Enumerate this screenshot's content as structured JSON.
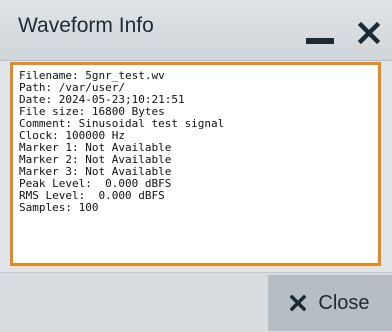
{
  "dialog": {
    "title": "Waveform Info",
    "close_label": "Close"
  },
  "info": {
    "lines": [
      "Filename: 5gnr_test.wv",
      "Path: /var/user/",
      "Date: 2024-05-23;10:21:51",
      "File size: 16800 Bytes",
      "Comment: Sinusoidal test signal",
      "Clock: 100000 Hz",
      "Marker 1: Not Available",
      "Marker 2: Not Available",
      "Marker 3: Not Available",
      "Peak Level:  0.000 dBFS",
      "RMS Level:  0.000 dBFS",
      "Samples: 100"
    ]
  },
  "icons": {
    "minimize": "minimize-icon",
    "close": "close-icon"
  },
  "colors": {
    "focus_border": "#e58a1e",
    "title_bar": "#d6dbdf",
    "button": "#b6bdc3",
    "text": "#1e2a33"
  }
}
